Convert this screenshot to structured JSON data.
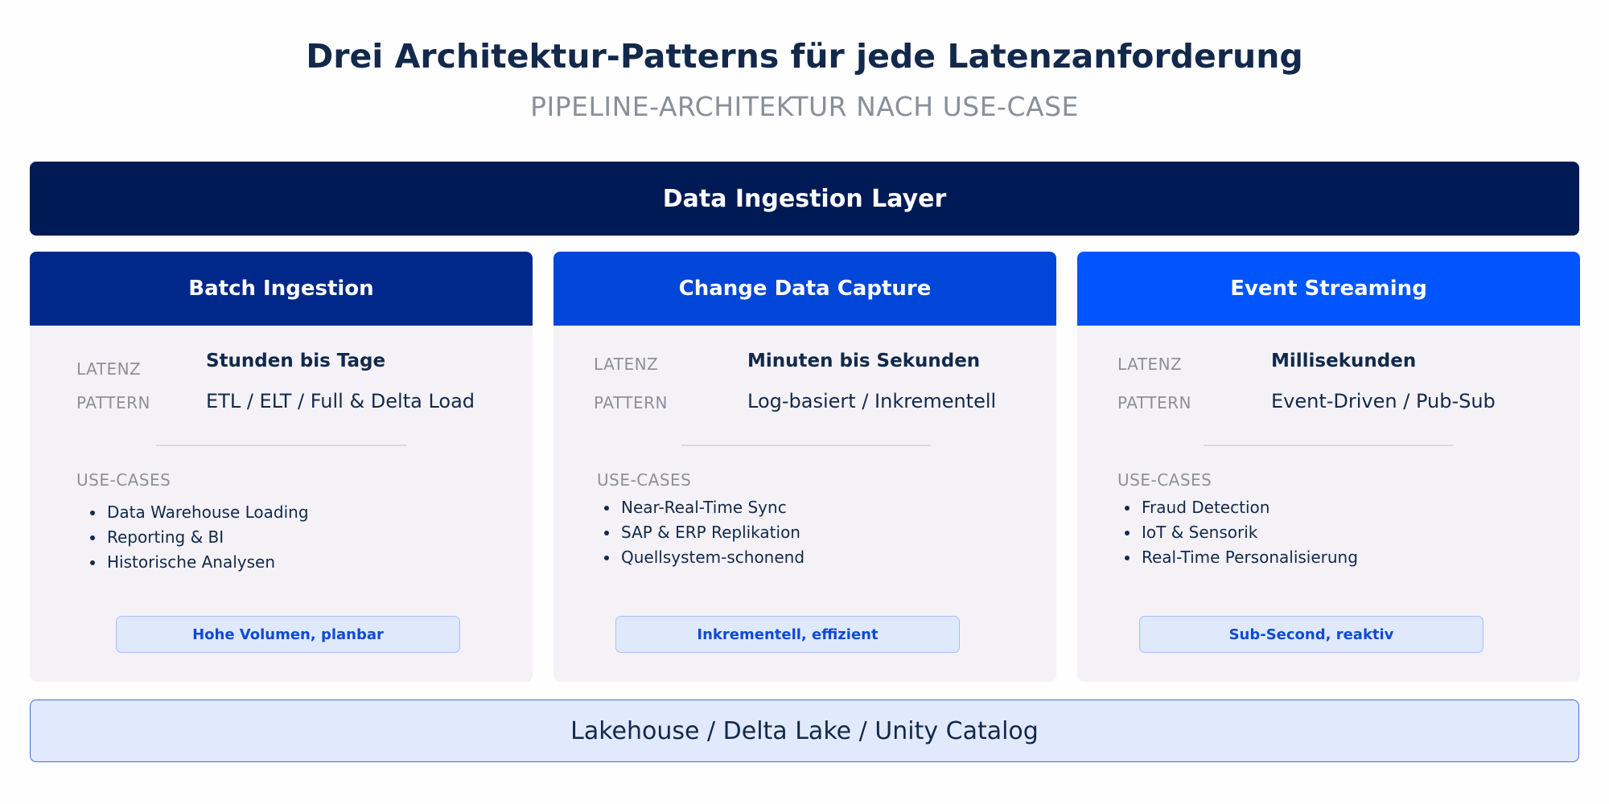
{
  "header": {
    "title": "Drei Architektur-Patterns für jede Latenzanforderung",
    "subtitle": "PIPELINE-ARCHITEKTUR NACH USE-CASE"
  },
  "layer": {
    "top_label": "Data Ingestion Layer",
    "bottom_label": "Lakehouse / Delta Lake / Unity Catalog"
  },
  "colors": {
    "layer_dark": "#001a55",
    "batch": "#00288a",
    "cdc": "#0046d8",
    "streaming": "#0055ff",
    "card_bg": "#f4f2f6",
    "pill_bg": "#e0e8fc",
    "pill_text": "#0e4ad6"
  },
  "columns": [
    {
      "title": "Batch Ingestion",
      "latenz_key": "LATENZ",
      "latenz_value": "Stunden bis Tage",
      "pattern_key": "PATTERN",
      "pattern_value": "ETL / ELT / Full & Delta Load",
      "usecases_label": "USE-CASES",
      "usecases": [
        "Data Warehouse Loading",
        "Reporting & BI",
        "Historische Analysen"
      ],
      "tag": "Hohe Volumen, planbar"
    },
    {
      "title": "Change Data Capture",
      "latenz_key": "LATENZ",
      "latenz_value": "Minuten bis Sekunden",
      "pattern_key": "PATTERN",
      "pattern_value": "Log-basiert / Inkrementell",
      "usecases_label": "USE-CASES",
      "usecases": [
        "Near-Real-Time Sync",
        "SAP & ERP Replikation",
        "Quellsystem-schonend"
      ],
      "tag": "Inkrementell, effizient"
    },
    {
      "title": "Event Streaming",
      "latenz_key": "LATENZ",
      "latenz_value": "Millisekunden",
      "pattern_key": "PATTERN",
      "pattern_value": "Event-Driven / Pub-Sub",
      "usecases_label": "USE-CASES",
      "usecases": [
        "Fraud Detection",
        "IoT & Sensorik",
        "Real-Time Personalisierung"
      ],
      "tag": "Sub-Second, reaktiv"
    }
  ]
}
